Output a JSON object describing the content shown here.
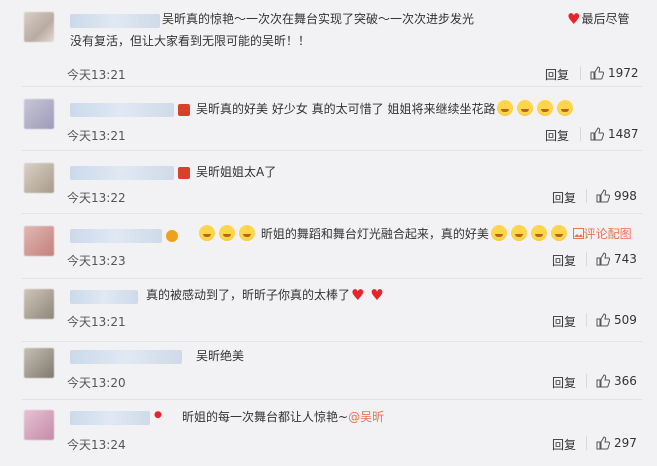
{
  "comments": [
    {
      "text_parts": [
        "吴昕真的惊艳～一次次在舞台实现了突破～一次次进步发光",
        "最后尽管没有复活，但让大家看到无限可能的吴昕！！"
      ],
      "time": "今天13:21",
      "reply": "回复",
      "likes": "1972"
    },
    {
      "text": "吴昕真的好美 好少女 真的太可惜了 姐姐将来继续坐花路",
      "time": "今天13:21",
      "reply": "回复",
      "likes": "1487"
    },
    {
      "text": "吴昕姐姐太A了",
      "time": "今天13:22",
      "reply": "回复",
      "likes": "998"
    },
    {
      "text": "昕姐的舞蹈和舞台灯光融合起来，真的好美",
      "link": "评论配图",
      "time": "今天13:23",
      "reply": "回复",
      "likes": "743"
    },
    {
      "text": "真的被感动到了，昕昕子你真的太棒了",
      "time": "今天13:21",
      "reply": "回复",
      "likes": "509"
    },
    {
      "text": "吴昕绝美",
      "time": "今天13:20",
      "reply": "回复",
      "likes": "366"
    },
    {
      "text": "昕姐的每一次舞台都让人惊艳~",
      "mention": "@吴昕",
      "time": "今天13:24",
      "reply": "回复",
      "likes": "297"
    }
  ],
  "colors": {
    "background": "#f2f2f5",
    "link": "#eb7350",
    "heart": "#e6252b"
  },
  "icons": {
    "like": "thumbs-up-icon",
    "emoji_cry": "crying-face-emoji",
    "heart": "red-heart-emoji"
  }
}
